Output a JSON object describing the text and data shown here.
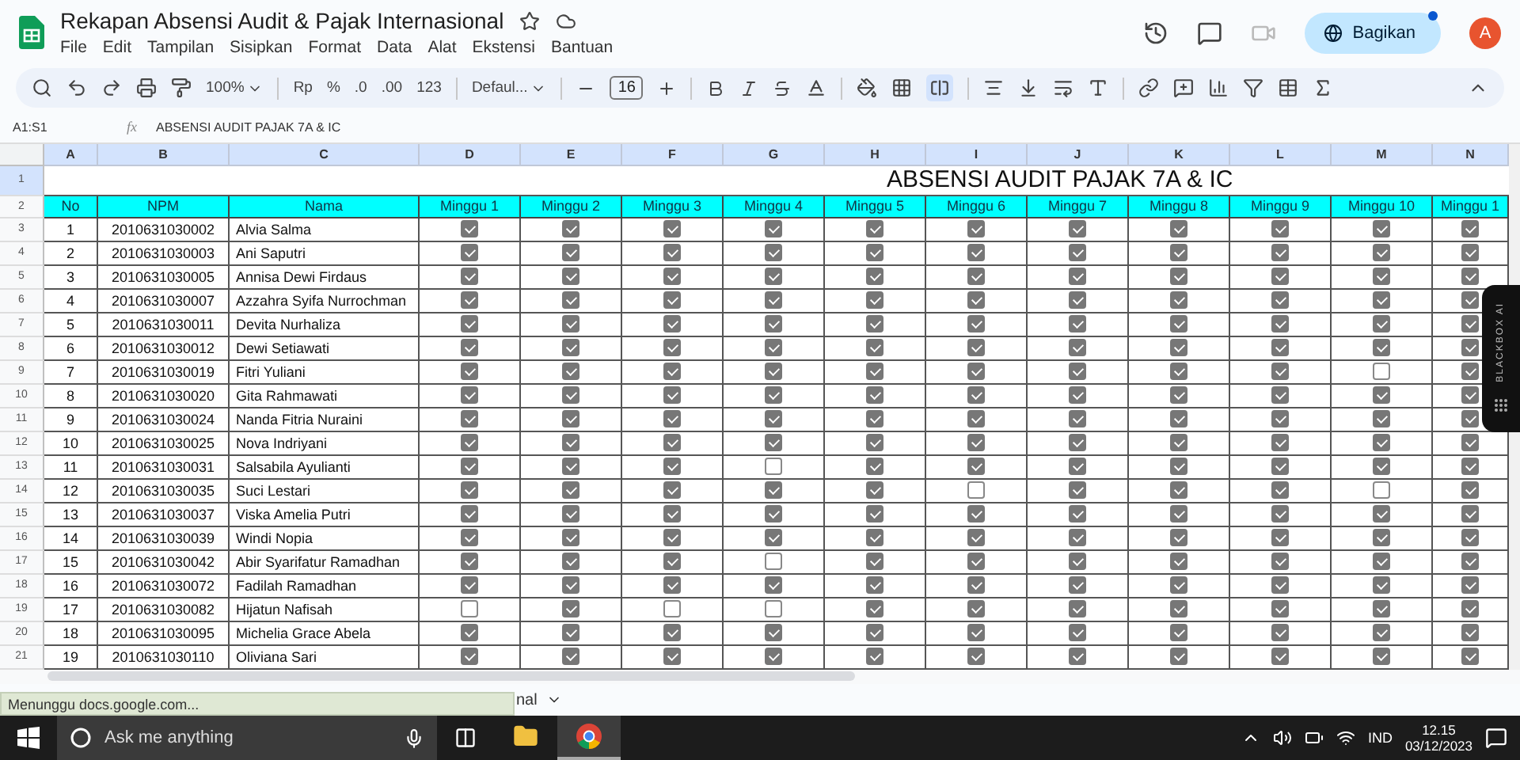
{
  "document": {
    "title": "Rekapan Absensi Audit & Pajak Internasional",
    "menu": [
      "File",
      "Edit",
      "Tampilan",
      "Sisipkan",
      "Format",
      "Data",
      "Alat",
      "Ekstensi",
      "Bantuan"
    ]
  },
  "share": {
    "label": "Bagikan"
  },
  "account": {
    "initial": "A"
  },
  "toolbar": {
    "zoom": "100%",
    "currency": "Rp",
    "percent": "%",
    "decrease_decimal": ".0",
    "increase_decimal": ".00",
    "number_format": "123",
    "font": "Defaul...",
    "font_size": "16",
    "merge_selected": true
  },
  "formula_bar": {
    "cell_range": "A1:S1",
    "function_label": "fx",
    "content": "ABSENSI AUDIT PAJAK 7A & IC"
  },
  "sheet": {
    "column_letters": [
      "A",
      "B",
      "C",
      "D",
      "E",
      "F",
      "G",
      "H",
      "I",
      "J",
      "K",
      "L",
      "M",
      "N"
    ],
    "row_numbers": [
      "1",
      "2",
      "3",
      "4",
      "5",
      "6",
      "7",
      "8",
      "9",
      "10",
      "11",
      "12",
      "13",
      "14",
      "15",
      "16",
      "17",
      "18",
      "19",
      "20",
      "21"
    ],
    "title": "ABSENSI AUDIT PAJAK 7A & IC",
    "headers": [
      "No",
      "NPM",
      "Nama",
      "Minggu 1",
      "Minggu 2",
      "Minggu 3",
      "Minggu 4",
      "Minggu 5",
      "Minggu 6",
      "Minggu 7",
      "Minggu 8",
      "Minggu 9",
      "Minggu 10",
      "Minggu 1"
    ],
    "rows": [
      {
        "no": "1",
        "npm": "2010631030002",
        "name": "Alvia Salma",
        "attendance": [
          true,
          true,
          true,
          true,
          true,
          true,
          true,
          true,
          true,
          true,
          true
        ]
      },
      {
        "no": "2",
        "npm": "2010631030003",
        "name": "Ani Saputri",
        "attendance": [
          true,
          true,
          true,
          true,
          true,
          true,
          true,
          true,
          true,
          true,
          true
        ]
      },
      {
        "no": "3",
        "npm": "2010631030005",
        "name": "Annisa Dewi Firdaus",
        "attendance": [
          true,
          true,
          true,
          true,
          true,
          true,
          true,
          true,
          true,
          true,
          true
        ]
      },
      {
        "no": "4",
        "npm": "2010631030007",
        "name": "Azzahra Syifa Nurrochman",
        "attendance": [
          true,
          true,
          true,
          true,
          true,
          true,
          true,
          true,
          true,
          true,
          true
        ]
      },
      {
        "no": "5",
        "npm": "2010631030011",
        "name": "Devita Nurhaliza",
        "attendance": [
          true,
          true,
          true,
          true,
          true,
          true,
          true,
          true,
          true,
          true,
          true
        ]
      },
      {
        "no": "6",
        "npm": "2010631030012",
        "name": "Dewi Setiawati",
        "attendance": [
          true,
          true,
          true,
          true,
          true,
          true,
          true,
          true,
          true,
          true,
          true
        ]
      },
      {
        "no": "7",
        "npm": "2010631030019",
        "name": "Fitri Yuliani",
        "attendance": [
          true,
          true,
          true,
          true,
          true,
          true,
          true,
          true,
          true,
          false,
          true
        ]
      },
      {
        "no": "8",
        "npm": "2010631030020",
        "name": "Gita Rahmawati",
        "attendance": [
          true,
          true,
          true,
          true,
          true,
          true,
          true,
          true,
          true,
          true,
          true
        ]
      },
      {
        "no": "9",
        "npm": "2010631030024",
        "name": "Nanda Fitria Nuraini",
        "attendance": [
          true,
          true,
          true,
          true,
          true,
          true,
          true,
          true,
          true,
          true,
          true
        ]
      },
      {
        "no": "10",
        "npm": "2010631030025",
        "name": "Nova Indriyani",
        "attendance": [
          true,
          true,
          true,
          true,
          true,
          true,
          true,
          true,
          true,
          true,
          true
        ]
      },
      {
        "no": "11",
        "npm": "2010631030031",
        "name": "Salsabila Ayulianti",
        "attendance": [
          true,
          true,
          true,
          false,
          true,
          true,
          true,
          true,
          true,
          true,
          true
        ]
      },
      {
        "no": "12",
        "npm": "2010631030035",
        "name": "Suci Lestari",
        "attendance": [
          true,
          true,
          true,
          true,
          true,
          false,
          true,
          true,
          true,
          false,
          true
        ]
      },
      {
        "no": "13",
        "npm": "2010631030037",
        "name": "Viska Amelia Putri",
        "attendance": [
          true,
          true,
          true,
          true,
          true,
          true,
          true,
          true,
          true,
          true,
          true
        ]
      },
      {
        "no": "14",
        "npm": "2010631030039",
        "name": "Windi Nopia",
        "attendance": [
          true,
          true,
          true,
          true,
          true,
          true,
          true,
          true,
          true,
          true,
          true
        ]
      },
      {
        "no": "15",
        "npm": "2010631030042",
        "name": "Abir Syarifatur Ramadhan",
        "attendance": [
          true,
          true,
          true,
          false,
          true,
          true,
          true,
          true,
          true,
          true,
          true
        ]
      },
      {
        "no": "16",
        "npm": "2010631030072",
        "name": "Fadilah Ramadhan",
        "attendance": [
          true,
          true,
          true,
          true,
          true,
          true,
          true,
          true,
          true,
          true,
          true
        ]
      },
      {
        "no": "17",
        "npm": "2010631030082",
        "name": "Hijatun Nafisah",
        "attendance": [
          false,
          true,
          false,
          false,
          true,
          true,
          true,
          true,
          true,
          true,
          true
        ]
      },
      {
        "no": "18",
        "npm": "2010631030095",
        "name": "Michelia Grace Abela",
        "attendance": [
          true,
          true,
          true,
          true,
          true,
          true,
          true,
          true,
          true,
          true,
          true
        ]
      },
      {
        "no": "19",
        "npm": "2010631030110",
        "name": "Oliviana Sari",
        "attendance": [
          true,
          true,
          true,
          true,
          true,
          true,
          true,
          true,
          true,
          true,
          true
        ]
      }
    ]
  },
  "sheet_tab": {
    "label": "nal"
  },
  "status_message": "Menunggu docs.google.com...",
  "side_widget": {
    "label": "BLACKBOX AI"
  },
  "taskbar": {
    "search_placeholder": "Ask me anything",
    "apps": [
      {
        "kind": "explorer",
        "selected": false
      },
      {
        "kind": "browser",
        "selected": true
      }
    ],
    "language": "IND",
    "time": "12.15",
    "date": "03/12/2023"
  }
}
